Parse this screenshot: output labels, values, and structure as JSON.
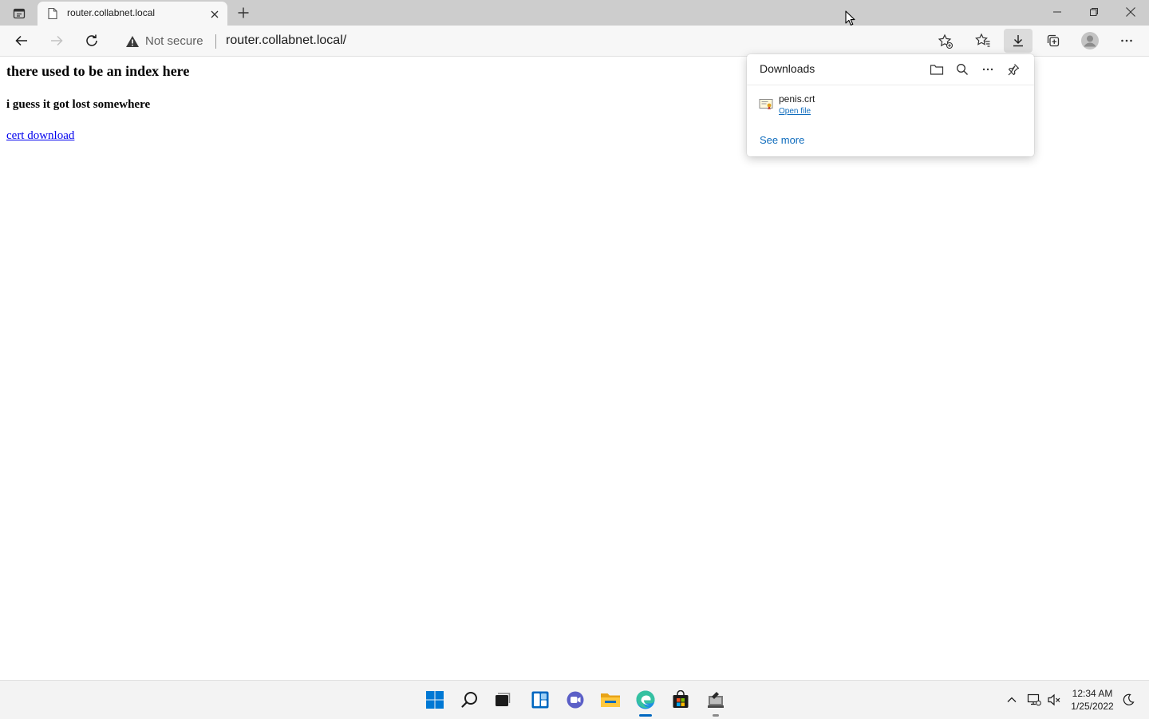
{
  "browser": {
    "tab": {
      "title": "router.collabnet.local",
      "icon": "page-icon"
    },
    "address_bar": {
      "security_label": "Not secure",
      "url": "router.collabnet.local/"
    },
    "icons": {
      "back": "arrow-left-icon",
      "forward": "arrow-right-icon",
      "reload": "reload-icon",
      "add_favorite": "star-plus-icon",
      "favorites": "favorites-icon",
      "downloads": "download-icon",
      "collections": "collections-icon",
      "profile": "profile-icon",
      "more": "more-icon"
    },
    "window_controls": [
      "minimize",
      "restore",
      "close"
    ]
  },
  "page": {
    "heading": "there used to be an index here",
    "subheading": "i guess it got lost somewhere",
    "link_text": "cert download"
  },
  "downloads_flyout": {
    "title": "Downloads",
    "items": [
      {
        "file_name": "penis.crt",
        "action": "Open file",
        "icon": "certificate-file-icon"
      }
    ],
    "see_more": "See more"
  },
  "taskbar": {
    "apps": [
      "Start",
      "Search",
      "Task View",
      "Widgets",
      "Chat",
      "File Explorer",
      "Microsoft Edge",
      "Microsoft Store",
      "App"
    ],
    "clock": {
      "time": "12:34 AM",
      "date": "1/25/2022"
    }
  },
  "colors": {
    "accent": "#0067c0",
    "link": "#0000ee",
    "flyout_link": "#0f6cbd",
    "tabstrip": "#cdcdcd",
    "toolbar": "#f7f7f7"
  }
}
